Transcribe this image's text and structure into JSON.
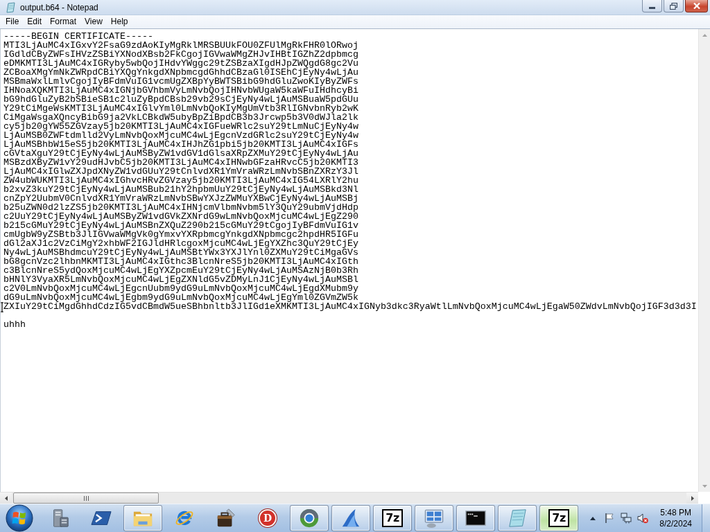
{
  "window": {
    "title": "output.b64 - Notepad",
    "buttons": [
      {
        "kind": "minimize"
      },
      {
        "kind": "restore"
      },
      {
        "kind": "close"
      }
    ]
  },
  "menu": [
    "File",
    "Edit",
    "Format",
    "View",
    "Help"
  ],
  "editor": {
    "blocks": [
      {
        "lines": [
          "-----BEGIN CERTIFICATE-----",
          "MTI3LjAuMC4xIGxvY2FsaG9zdAoKIyMgRklMRSBUUkFOU0ZFUlMgRkFHR0lORwoj",
          "IGdldCByZWFsIHVzZSBiYXNodXBsb2FkCgojIGVwaWMgZHJvIHBtIGZhZ2dpbmcg",
          "eDMKMTI3LjAuMC4xIGRyby5wbQojIHdvYWggc29tZSBzaXIgdHJpZWQgdG8gc2Vu",
          "ZCBoaXMgYmNkZWRpdCBiYXQgYnkgdXNpbmcgdGhhdCBzaGl0ISEhCjEyNy4wLjAu",
          "MSBmaWxlLmlvCgojIyBFdmVuIG1vcmUgZXBpYyBWTSBibG9hdGluZwoKIyByZWFs",
          "IHNoaXQKMTI3LjAuMC4xIGNjbGVhbmVyLmNvbQojIHNvbWUgaW5kaWFuIHdhcyBi",
          "bG9hdGluZyB2bSBieSB1c2luZyBpdCBsb29vb29sCjEyNy4wLjAuMSBuaW5pdGUu",
          "Y29tCiMgeWsKMTI3LjAuMC4xIGlvYml0LmNvbQoKIyMgUmVtb3RlIGNvbnRyb2wK",
          "CiMgaWsgaXQncyBibG9ja2VkLCBkdW5ubyBpZiBpdCB3b3Jrcwp5b3V0dWJla2lk",
          "cy5jb20gYW55ZGVzay5jb20KMTI3LjAuMC4xIGFueWRlc2suY29tLmNuCjEyNy4w",
          "LjAuMSB0ZWFtdmlld2VyLmNvbQoxMjcuMC4wLjEgcnVzdGRlc2suY29tCjEyNy4w",
          "LjAuMSBhbW15eS5jb20KMTI3LjAuMC4xIHJhZG1pbi5jb20KMTI3LjAuMC4xIGFs",
          "cGVtaXguY29tCjEyNy4wLjAuMSByZW1vdGV1dGlsaXRpZXMuY29tCjEyNy4wLjAu",
          "MSBzdXByZW1vY29udHJvbC5jb20KMTI3LjAuMC4xIHNwbGFzaHRvcC5jb20KMTI3",
          "LjAuMC4xIGlwZXJpdXNyZW1vdGUuY29tCnlvdXR1YmVraWRzLmNvbSBnZXRzY3Jl",
          "ZW4ubWUKMTI3LjAuMC4xIGhvcHRvZGVzay5jb20KMTI3LjAuMC4xIG54LXRlY2hu",
          "b2xvZ3kuY29tCjEyNy4wLjAuMSBub21hY2hpbmUuY29tCjEyNy4wLjAuMSBkd3Nl",
          "cnZpY2UubmV0CnlvdXR1YmVraWRzLmNvbSBwYXJzZWMuYXBwCjEyNy4wLjAuMSBj",
          "b25uZWN0d2lzZS5jb20KMTI3LjAuMC4xIHNjcmVlbmNvbm5lY3QuY29ubmVjdHdp",
          "c2UuY29tCjEyNy4wLjAuMSByZW1vdGVkZXNrdG9wLmNvbQoxMjcuMC4wLjEgZ290",
          "b215cGMuY29tCjEyNy4wLjAuMSBnZXQuZ290b215cGMuY29tCgojIyBFdmVuIG1v",
          "cmUgbW9yZSBtb3JlIGVwaWMgVk0gYmxvYXRpbmcgYnkgdXNpbmcgc2hpdHR5IGFu",
          "dGl2aXJ1c2VzCiMgY2xhbWF2IGJldHRlcgoxMjcuMC4wLjEgYXZhc3QuY29tCjEy",
          "Ny4wLjAuMSBhdmcuY29tCjEyNy4wLjAuMSBtYWx3YXJlYnl0ZXMuY29tCiMgaGVs",
          "bG8gcnVzc2lhbnMKMTI3LjAuMC4xIGthc3BlcnNreS5jb20KMTI3LjAuMC4xIGth",
          "c3BlcnNreS5ydQoxMjcuMC4wLjEgYXZpcmEuY29tCjEyNy4wLjAuMSAzNjB0b3Rh",
          "bHNlY3VyaXR5LmNvbQoxMjcuMC4wLjEgZXNldG5vZDMyLnJ1CjEyNy4wLjAuMSBl",
          "c2V0LmNvbQoxMjcuMC4wLjEgcnUubm9ydG9uLmNvbQoxMjcuMC4wLjEgdXMubm9y",
          "dG9uLmNvbQoxMjcuMC4wLjEgbm9ydG9uLmNvbQoxMjcuMC4wLjEgYml0ZGVmZW5k",
          "ZXIuY29tCiMgdGhhdCdzIG5vdCBmdW5ueSBhbnltb3JlIGd1eXMKMTI3LjAuMC4xIGNyb3dkc3RyaWtlLmNvbQoxMjcuMC4wLjEgaW50ZWdvLmNvbQojIGF3d3d3I"
        ]
      },
      {
        "lines": [
          "uhhh"
        ]
      }
    ]
  },
  "taskbar": {
    "items": [
      {
        "kind": "server",
        "running": false,
        "highlighted": false
      },
      {
        "kind": "shell",
        "running": false,
        "highlighted": false
      },
      {
        "kind": "folder",
        "running": true,
        "highlighted": false
      },
      {
        "kind": "orbit",
        "running": false,
        "highlighted": false
      },
      {
        "kind": "toolbox",
        "running": false,
        "highlighted": false
      },
      {
        "kind": "letter-disc",
        "label": "D",
        "running": false,
        "highlighted": false
      },
      {
        "kind": "disc",
        "running": true,
        "highlighted": false
      },
      {
        "kind": "fin",
        "running": true,
        "highlighted": false
      },
      {
        "kind": "letter-square",
        "label": "7z",
        "running": true,
        "highlighted": false
      },
      {
        "kind": "panels",
        "running": true,
        "highlighted": false
      },
      {
        "kind": "terminal",
        "running": true,
        "highlighted": false
      },
      {
        "kind": "notepad",
        "running": true,
        "highlighted": false
      },
      {
        "kind": "letter-square",
        "label": "7z",
        "running": true,
        "highlighted": true
      }
    ],
    "tray": {
      "volume_muted": true
    },
    "time": "5:48 PM",
    "date": "8/2/2024"
  }
}
